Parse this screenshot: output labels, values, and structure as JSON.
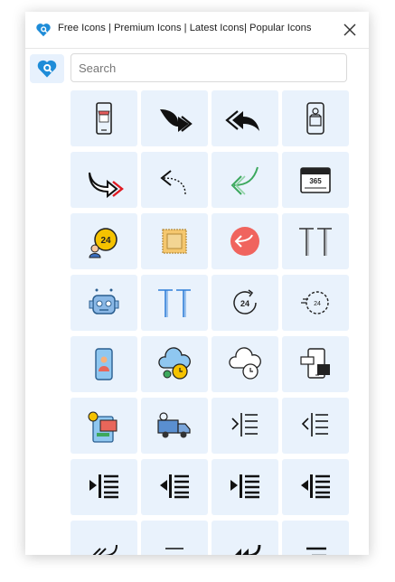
{
  "header": {
    "title": "Free Icons | Premium Icons | Latest Icons| Popular Icons",
    "brand_color": "#1e8cd8"
  },
  "search": {
    "placeholder": "Search",
    "value": ""
  },
  "icons": [
    "mobile-shop-icon",
    "share-forward-arrow-icon",
    "reply-all-arrow-icon",
    "mobile-store-icon",
    "curved-forward-arrow-icon",
    "dotted-back-arrow-icon",
    "green-reply-arrow-icon",
    "calendar-365-icon",
    "support-24-person-icon",
    "dotted-square-icon",
    "red-reply-circle-icon",
    "double-t-text-icon",
    "robot-face-icon",
    "double-t-blue-text-icon",
    "clock-24-outline-icon",
    "timer-24-icon",
    "mobile-person-icon",
    "cloud-clock-icon",
    "cloud-clock-outline-icon",
    "mobile-chat-icon",
    "tablet-chat-icon",
    "delivery-truck-icon",
    "indent-right-icon",
    "indent-left-icon",
    "indent-right-filled-icon",
    "indent-left-filled-icon",
    "indent-right-filled-icon",
    "indent-left-filled-icon",
    "rewind-arrow-icon",
    "align-center-icon",
    "fast-rewind-arrow-icon",
    "align-right-icon"
  ]
}
